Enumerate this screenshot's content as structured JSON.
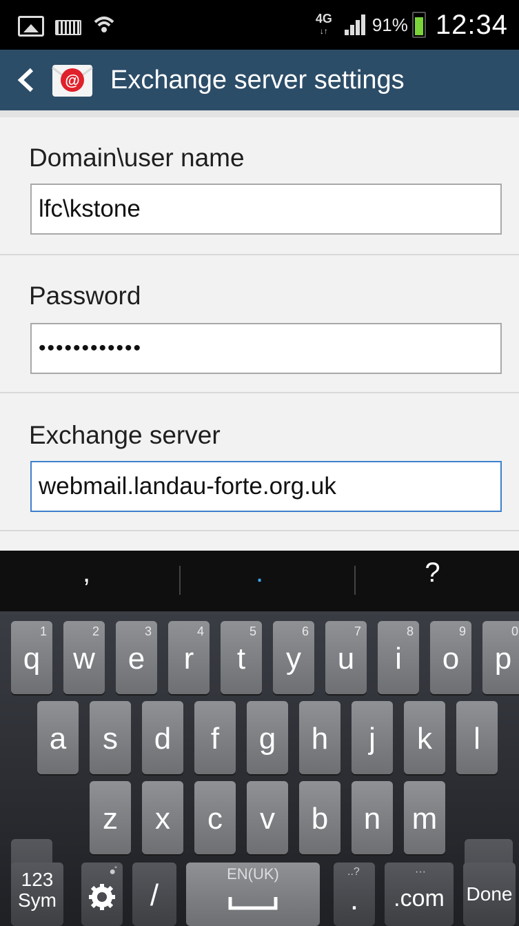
{
  "status_bar": {
    "network": "4G",
    "battery_percent": "91%",
    "battery_level": 0.91,
    "time": "12:34",
    "icons": [
      "gallery-icon",
      "keyboard-icon",
      "wifi-sync-icon",
      "signal-icon",
      "battery-icon"
    ]
  },
  "action_bar": {
    "title": "Exchange server settings",
    "app_icon": "email-app-icon",
    "accent": "#2c4d68"
  },
  "form": {
    "fields": [
      {
        "label": "Domain\\user name",
        "value": "lfc\\kstone"
      },
      {
        "label": "Password",
        "value": "••••••••••••"
      },
      {
        "label": "Exchange server",
        "value": "webmail.landau-forte.org.uk"
      }
    ],
    "focus_color": "#3e7fcc"
  },
  "keyboard": {
    "suggestions": [
      ",",
      ".",
      "?"
    ],
    "row1": [
      {
        "letter": "q",
        "num": "1"
      },
      {
        "letter": "w",
        "num": "2"
      },
      {
        "letter": "e",
        "num": "3"
      },
      {
        "letter": "r",
        "num": "4"
      },
      {
        "letter": "t",
        "num": "5"
      },
      {
        "letter": "y",
        "num": "6"
      },
      {
        "letter": "u",
        "num": "7"
      },
      {
        "letter": "i",
        "num": "8"
      },
      {
        "letter": "o",
        "num": "9"
      },
      {
        "letter": "p",
        "num": "0"
      }
    ],
    "row2": [
      "a",
      "s",
      "d",
      "f",
      "g",
      "h",
      "j",
      "k",
      "l"
    ],
    "row3": [
      "z",
      "x",
      "c",
      "v",
      "b",
      "n",
      "m"
    ],
    "sym_top": "123",
    "sym_bottom": "Sym",
    "slash": "/",
    "space_label": "EN(UK)",
    "period": ".",
    "period_hint": "..?",
    "dotcom": ".com",
    "done": "Done"
  }
}
